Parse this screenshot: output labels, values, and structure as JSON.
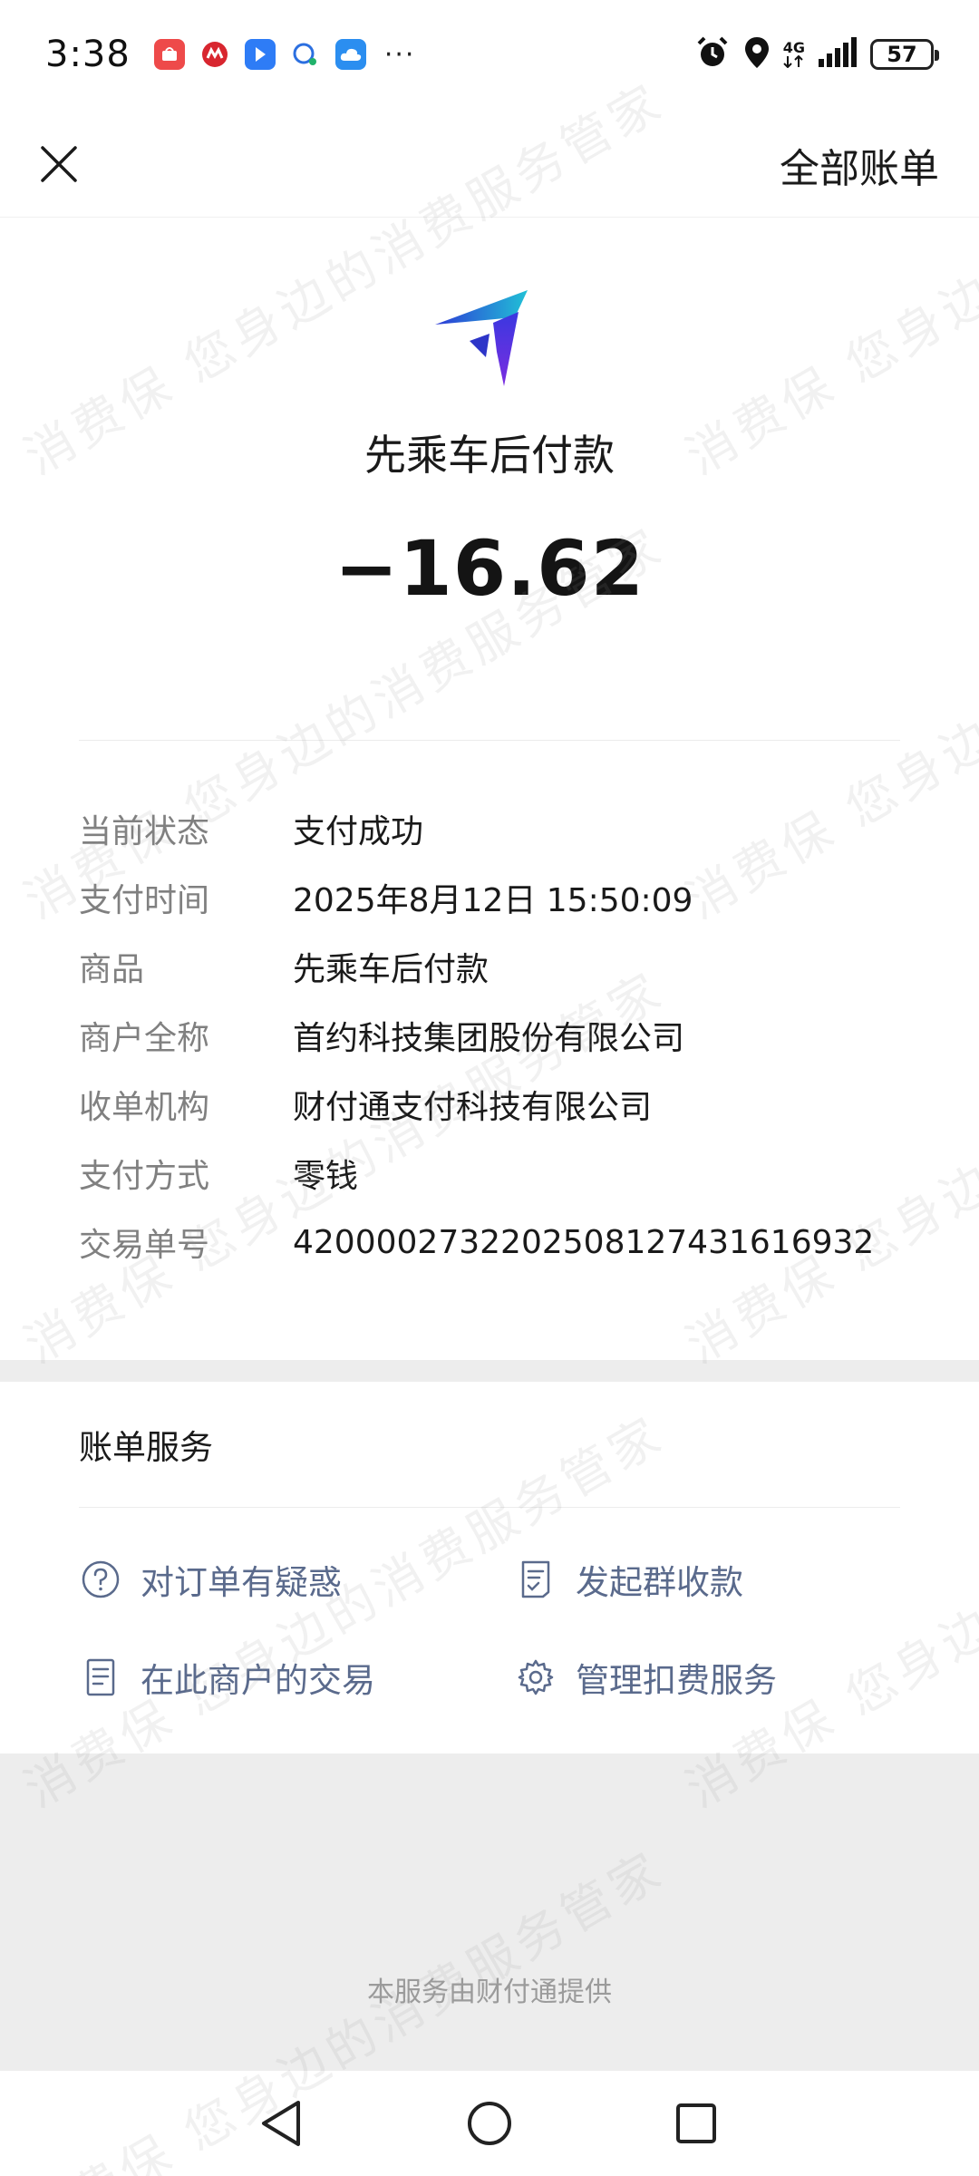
{
  "status_bar": {
    "time": "3:38",
    "network": "4G",
    "battery": "57",
    "more": "···",
    "icons": [
      "mall-app-icon",
      "cmb-bank-icon",
      "map-app-icon",
      "chat-app-icon",
      "cloud-app-icon",
      "alarm-icon",
      "location-icon",
      "signal-icon",
      "battery-icon"
    ]
  },
  "nav": {
    "close_icon": "close-icon",
    "all_bills": "全部账单"
  },
  "merchant": {
    "name": "先乘车后付款",
    "amount": "−16.62",
    "logo_colors": [
      "#2d3ad6",
      "#21c1d6",
      "#7b2de0"
    ]
  },
  "details": [
    {
      "label": "当前状态",
      "value": "支付成功"
    },
    {
      "label": "支付时间",
      "value": "2025年8月12日 15:50:09"
    },
    {
      "label": "商品",
      "value": "先乘车后付款"
    },
    {
      "label": "商户全称",
      "value": "首约科技集团股份有限公司"
    },
    {
      "label": "收单机构",
      "value": "财付通支付科技有限公司"
    },
    {
      "label": "支付方式",
      "value": "零钱"
    },
    {
      "label": "交易单号",
      "value": "4200002732202508127431616932"
    }
  ],
  "services": {
    "title": "账单服务",
    "items": [
      {
        "label": "对订单有疑惑",
        "icon": "question-icon"
      },
      {
        "label": "发起群收款",
        "icon": "receipt-icon"
      },
      {
        "label": "在此商户的交易",
        "icon": "document-icon"
      },
      {
        "label": "管理扣费服务",
        "icon": "gear-icon"
      }
    ]
  },
  "footer": {
    "text": "本服务由财付通提供"
  },
  "watermark": {
    "text": "消费保 您身边的消费服务管家"
  },
  "colors": {
    "label_gray": "#808080",
    "service_link": "#5a6a8c",
    "band_gray": "#ededed"
  }
}
